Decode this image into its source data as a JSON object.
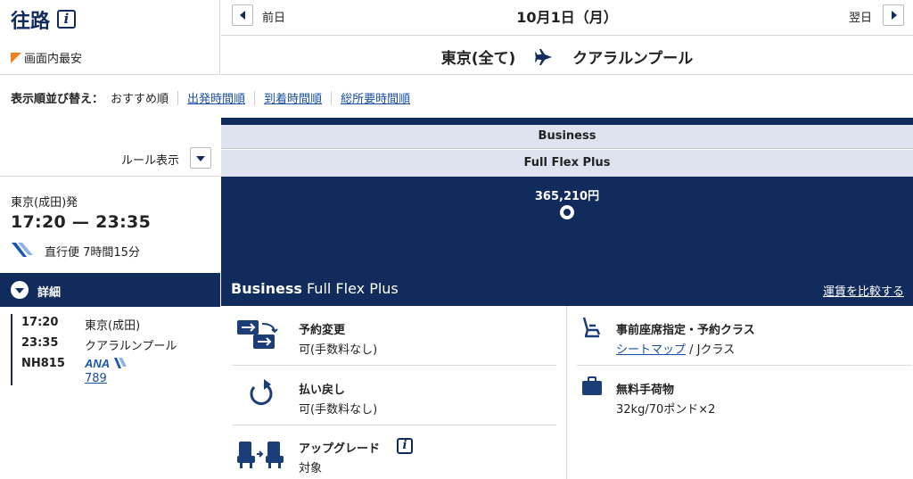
{
  "header": {
    "title": "往路",
    "cheapest_label": "画面内最安",
    "prev_label": "前日",
    "date": "10月1日（月）",
    "next_label": "翌日",
    "origin": "東京(全て)",
    "destination": "クアラルンプール"
  },
  "sort": {
    "label": "表示順並び替え：",
    "options": [
      "おすすめ順",
      "出発時間順",
      "到着時間順",
      "総所要時間順"
    ]
  },
  "rules": {
    "label": "ルール表示"
  },
  "flight": {
    "departure": "東京(成田)発",
    "time_range": "17:20 — 23:35",
    "nonstop": "直行便 7時間15分",
    "detail_label": "詳細",
    "segments": [
      {
        "time": "17:20",
        "place": "東京(成田)"
      },
      {
        "time": "23:35",
        "place": "クアラルンプール"
      }
    ],
    "flight_no": "NH815",
    "airline_logo": "ANA",
    "aircraft": "789"
  },
  "fare": {
    "cabin": "Business",
    "fare_type": "Full Flex Plus",
    "price": "365,210円",
    "panel_title_bold": "Business",
    "panel_title_rest": " Full Flex Plus",
    "compare_link": "運賃を比較する"
  },
  "conditions": {
    "change": {
      "title": "予約変更",
      "value": "可(手数料なし)",
      "icon": "change-reservation-icon"
    },
    "refund": {
      "title": "払い戻し",
      "value": "可(手数料なし)",
      "icon": "refund-icon"
    },
    "upgrade": {
      "title": "アップグレード",
      "value": "対象",
      "icon": "upgrade-seat-icon"
    },
    "seat": {
      "title": "事前座席指定・予約クラス",
      "link": "シートマップ",
      "value": " / Jクラス",
      "icon": "seat-icon"
    },
    "baggage": {
      "title": "無料手荷物",
      "value": "32kg/70ポンド×2",
      "icon": "baggage-icon"
    }
  },
  "colors": {
    "navy": "#112b5c",
    "light_header": "#dfe3ef",
    "cheapest": "#f08020",
    "link": "#1a4fa0"
  }
}
